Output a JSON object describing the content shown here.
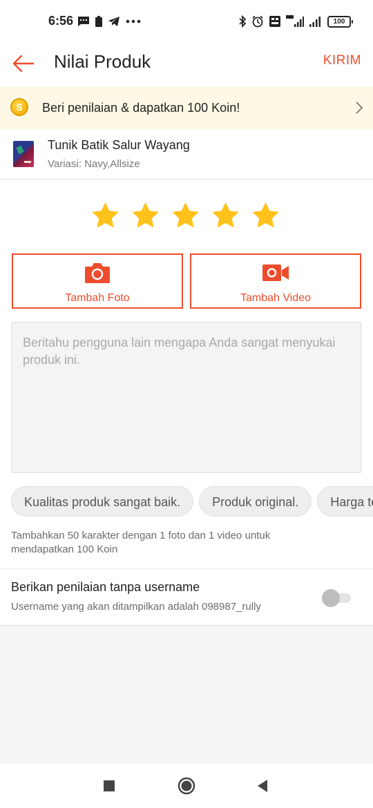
{
  "status_bar": {
    "time": "6:56",
    "battery": "100",
    "left_icons": [
      "message-icon",
      "battery-saver-icon",
      "telegram-icon",
      "more-dots-icon"
    ],
    "right_icons": [
      "bluetooth-icon",
      "alarm-icon",
      "volte-icon",
      "signal-4g-icon",
      "signal-icon",
      "battery-icon"
    ]
  },
  "header": {
    "title": "Nilai Produk",
    "send_label": "KIRIM"
  },
  "coin_banner": {
    "text": "Beri penilaian & dapatkan 100 Koin!",
    "coin_symbol": "S"
  },
  "product": {
    "name": "Tunik Batik Salur Wayang",
    "variant": "Variasi: Navy,Allsize"
  },
  "rating": {
    "stars": 5,
    "max": 5
  },
  "media": {
    "add_photo_label": "Tambah Foto",
    "add_video_label": "Tambah Video"
  },
  "review": {
    "value": "",
    "placeholder": "Beritahu pengguna lain mengapa Anda sangat menyukai produk ini."
  },
  "suggestion_chips": [
    "Kualitas produk sangat baik.",
    "Produk original.",
    "Harga terjangkau."
  ],
  "hint": "Tambahkan 50 karakter dengan 1 foto dan 1 video untuk mendapatkan 100 Koin",
  "anonymous": {
    "title": "Berikan penilaian tanpa username",
    "subtitle": "Username yang akan ditampilkan adalah 098987_rully",
    "enabled": false
  },
  "colors": {
    "accent": "#ee4d2d",
    "star": "#ffc21a",
    "banner_bg": "#fef8e5"
  }
}
